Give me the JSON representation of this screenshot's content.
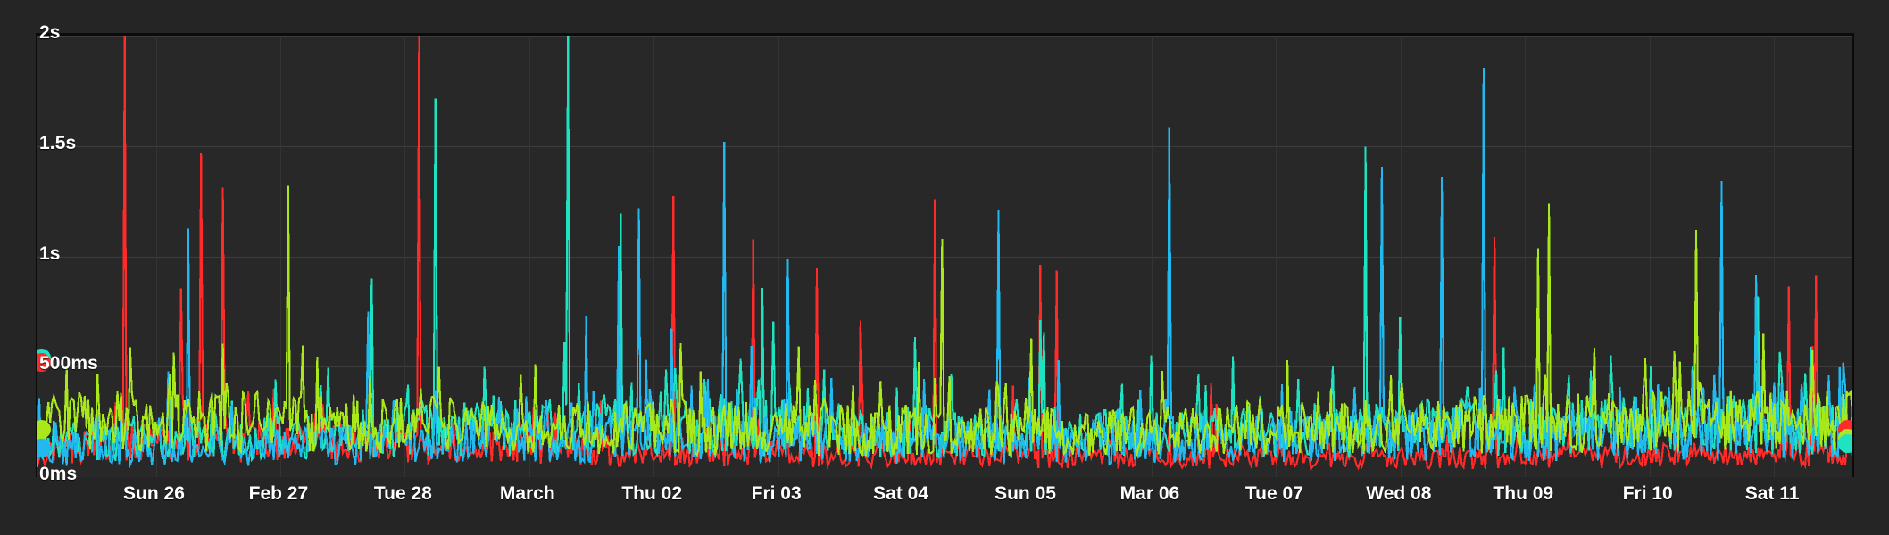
{
  "chart": {
    "title": "",
    "background": "#252525",
    "plot_background": "#282828",
    "grid_color": "#3d3d3d",
    "axis_color": "#0b0b0b",
    "text_color": "#ffffff"
  },
  "chart_data": {
    "type": "line",
    "title": "",
    "subtitle": "",
    "xlabel": "",
    "ylabel": "",
    "grid": true,
    "legend": "none",
    "ylim": [
      0,
      2000
    ],
    "yunit": "ms",
    "ytick_labels": [
      "2s",
      "1.5s",
      "1s",
      "500ms",
      "0ms"
    ],
    "ytick_values": [
      2000,
      1500,
      1000,
      500,
      0
    ],
    "xtick_labels": [
      "Sun 26",
      "Feb 27",
      "Tue 28",
      "March",
      "Thu 02",
      "Fri 03",
      "Sat 04",
      "Sun 05",
      "Mar 06",
      "Tue 07",
      "Wed 08",
      "Thu 09",
      "Fri 10",
      "Sat 11"
    ],
    "x_range": [
      "Feb 25",
      "Mar 11"
    ],
    "series": [
      {
        "name": "series-red",
        "color": "#ff2a2a",
        "baseline": 120,
        "noise": 70,
        "spike_rate": 0.11,
        "spike_max": 2000,
        "seed": 11,
        "trend": [
          1.0,
          1.35,
          1.3,
          1.15,
          1.0,
          0.92,
          0.8,
          0.78,
          0.72,
          0.7,
          0.72,
          0.78,
          0.82,
          0.8
        ]
      },
      {
        "name": "series-cyan",
        "color": "#1fe3c0",
        "baseline": 190,
        "noise": 110,
        "spike_rate": 0.13,
        "spike_max": 1900,
        "seed": 29,
        "trend": [
          0.85,
          0.95,
          1.0,
          1.15,
          1.25,
          1.2,
          1.1,
          1.0,
          1.05,
          1.12,
          1.18,
          1.2,
          1.25,
          1.2
        ]
      },
      {
        "name": "series-lightblue",
        "color": "#22b8f0",
        "baseline": 150,
        "noise": 95,
        "spike_rate": 0.12,
        "spike_max": 1450,
        "seed": 47,
        "trend": [
          0.8,
          0.9,
          0.95,
          1.05,
          1.15,
          1.18,
          1.1,
          1.05,
          1.12,
          1.2,
          1.3,
          1.32,
          1.3,
          1.25
        ]
      },
      {
        "name": "series-yellowgreen",
        "color": "#a9e81b",
        "baseline": 235,
        "noise": 130,
        "spike_rate": 0.075,
        "spike_max": 1250,
        "seed": 73,
        "trend": [
          1.05,
          1.1,
          1.05,
          1.0,
          0.95,
          0.95,
          0.9,
          0.88,
          0.9,
          0.95,
          1.0,
          1.05,
          1.1,
          1.08
        ]
      }
    ],
    "endpoint_markers_left": [
      {
        "name": "marker-cyan-left",
        "color": "#1fe3c0",
        "value": 540
      },
      {
        "name": "marker-red-left",
        "color": "#ff2a2a",
        "value": 520
      },
      {
        "name": "marker-yellowgreen-left",
        "color": "#a9e81b",
        "value": 215
      },
      {
        "name": "marker-lightblue-left",
        "color": "#22b8f0",
        "value": 130
      }
    ],
    "endpoint_markers_right": [
      {
        "name": "marker-red-right",
        "color": "#ff2a2a",
        "value": 215
      },
      {
        "name": "marker-yellowgreen-right",
        "color": "#a9e81b",
        "value": 175
      },
      {
        "name": "marker-cyan-right",
        "color": "#1fe3c0",
        "value": 150
      }
    ]
  }
}
